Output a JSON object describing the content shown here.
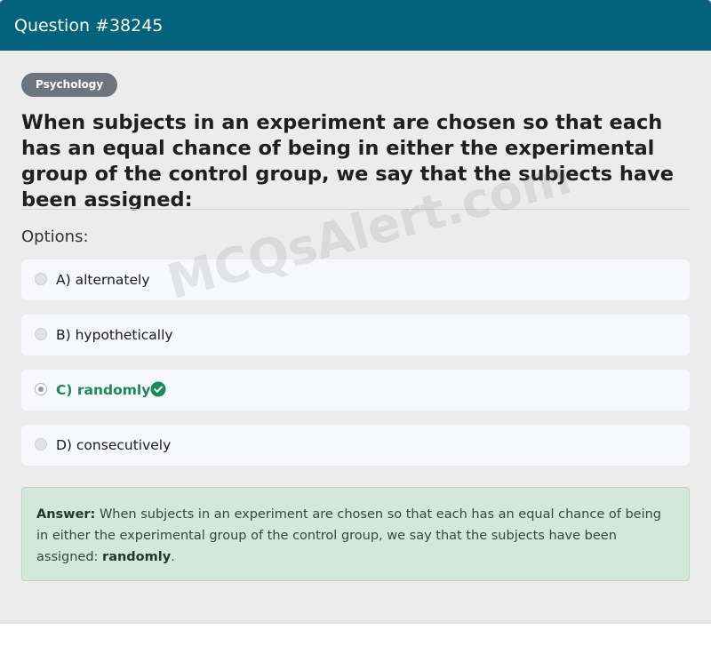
{
  "header": {
    "title": "Question #38245"
  },
  "question": {
    "category": "Psychology",
    "text": "When subjects in an experiment are chosen so that each has an equal chance of being in either the experimental group of the control group, we say that the subjects have been assigned:",
    "options_label": "Options:",
    "options": [
      {
        "label": "A) alternately",
        "selected": false,
        "correct": false
      },
      {
        "label": "B) hypothetically",
        "selected": false,
        "correct": false
      },
      {
        "label": "C) randomly",
        "selected": true,
        "correct": true
      },
      {
        "label": "D) consecutively",
        "selected": false,
        "correct": false
      }
    ]
  },
  "answer": {
    "label": "Answer:",
    "text": " When subjects in an experiment are chosen so that each has an equal chance of being in either the experimental group of the control group, we say that the subjects have been assigned: ",
    "value": "randomly",
    "end": "."
  },
  "watermark": {
    "text": "MCQsAlert.com"
  },
  "colors": {
    "header_bg": "#03627c",
    "correct_text": "#1b8a57",
    "answer_bg": "#d4e7dc",
    "badge_bg": "#6c757d"
  },
  "icons": {
    "correct": "check-circle-icon"
  }
}
